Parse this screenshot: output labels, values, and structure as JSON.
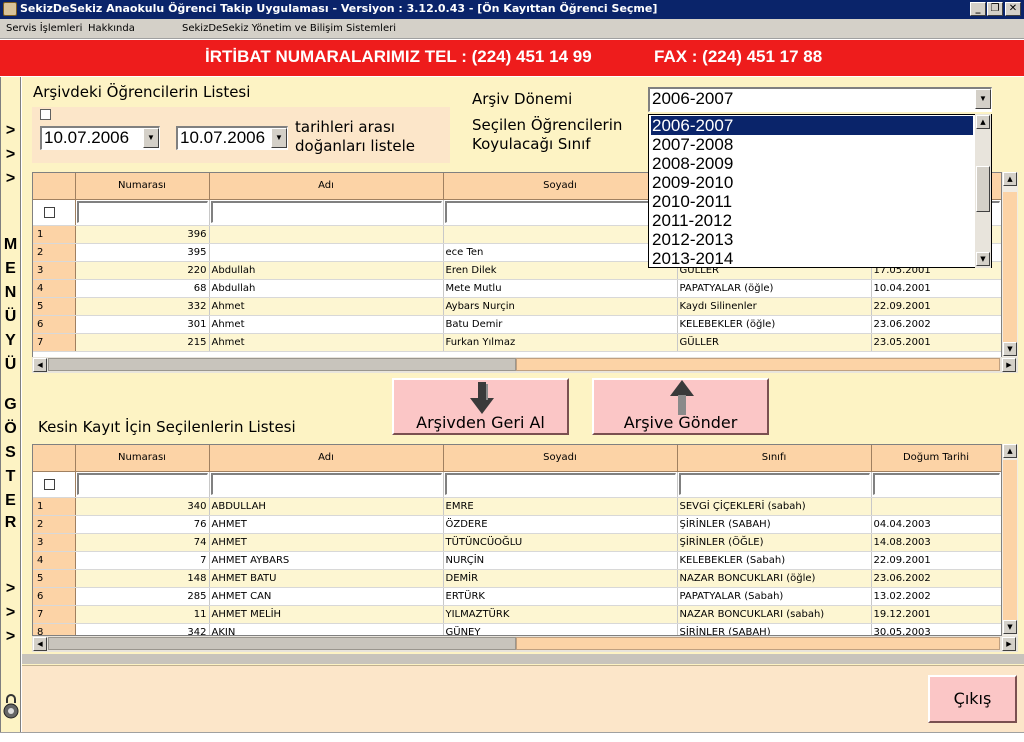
{
  "window": {
    "title": "SekizDeSekiz Anaokulu Öğrenci Takip Uygulaması - Versiyon : 3.12.0.43 - [Ön Kayıttan Öğrenci Seçme]"
  },
  "menu": {
    "items": [
      "Servis İşlemleri",
      "Hakkında"
    ],
    "right_label": "SekizDeSekiz Yönetim ve Bilişim Sistemleri"
  },
  "banner": {
    "tel": "İRTİBAT NUMARALARIMIZ  TEL : (224) 451 14 99",
    "fax": "FAX : (224) 451 17 88",
    "color": "#ee1c1c"
  },
  "side_menu": {
    "arrows_top": [
      ">",
      ">",
      ">"
    ],
    "letters": [
      "M",
      "E",
      "N",
      "Ü",
      "Y",
      "Ü",
      "",
      "G",
      "Ö",
      "S",
      "T",
      "E",
      "R"
    ],
    "arrows_bottom": [
      ">",
      ">",
      ">"
    ]
  },
  "archive": {
    "title": "Arşivdeki Öğrencilerin Listesi",
    "date_from": "10.07.2006",
    "date_to": "10.07.2006",
    "date_label_line1": "tarihleri arası",
    "date_label_line2": "doğanları listele",
    "period_label": "Arşiv Dönemi",
    "target_label_line1": "Seçilen Öğrencilerin",
    "target_label_line2": "Koyulacağı Sınıf",
    "period_value": "2006-2007",
    "period_options": [
      "2006-2007",
      "2007-2008",
      "2008-2009",
      "2009-2010",
      "2010-2011",
      "2011-2012",
      "2012-2013",
      "2013-2014"
    ],
    "columns": [
      "Numarası",
      "Adı",
      "Soyadı",
      "",
      ""
    ],
    "rows": [
      {
        "no": "1",
        "num": "396",
        "name": "",
        "surname": "",
        "cls": "",
        "dob": ""
      },
      {
        "no": "2",
        "num": "395",
        "name": "",
        "surname": "ece Ten",
        "cls": "",
        "dob": ""
      },
      {
        "no": "3",
        "num": "220",
        "name": "Abdullah",
        "surname": "Eren Dilek",
        "cls": "GÜLLER",
        "dob": "17.05.2001"
      },
      {
        "no": "4",
        "num": "68",
        "name": "Abdullah",
        "surname": "Mete Mutlu",
        "cls": "PAPATYALAR (öğle)",
        "dob": "10.04.2001"
      },
      {
        "no": "5",
        "num": "332",
        "name": "Ahmet",
        "surname": "Aybars Nurçin",
        "cls": "Kaydı Silinenler",
        "dob": "22.09.2001"
      },
      {
        "no": "6",
        "num": "301",
        "name": "Ahmet",
        "surname": "Batu Demir",
        "cls": "KELEBEKLER (öğle)",
        "dob": "23.06.2002"
      },
      {
        "no": "7",
        "num": "215",
        "name": "Ahmet",
        "surname": "Furkan Yılmaz",
        "cls": "GÜLLER",
        "dob": "23.05.2001"
      }
    ]
  },
  "buttons": {
    "restore": "Arşivden Geri Al",
    "archive": "Arşive Gönder",
    "exit": "Çıkış"
  },
  "final": {
    "title": "Kesin Kayıt İçin Seçilenlerin Listesi",
    "columns": [
      "Numarası",
      "Adı",
      "Soyadı",
      "Sınıfı",
      "Doğum Tarihi"
    ],
    "rows": [
      {
        "no": "1",
        "num": "340",
        "name": "ABDULLAH",
        "surname": "EMRE",
        "cls": "SEVGİ ÇİÇEKLERİ (sabah)",
        "dob": ""
      },
      {
        "no": "2",
        "num": "76",
        "name": "AHMET",
        "surname": "ÖZDERE",
        "cls": "ŞİRİNLER (SABAH)",
        "dob": "04.04.2003"
      },
      {
        "no": "3",
        "num": "74",
        "name": "AHMET",
        "surname": "TÜTÜNCÜOĞLU",
        "cls": "ŞİRİNLER (ÖĞLE)",
        "dob": "14.08.2003"
      },
      {
        "no": "4",
        "num": "7",
        "name": "AHMET AYBARS",
        "surname": "NURÇİN",
        "cls": "KELEBEKLER (Sabah)",
        "dob": "22.09.2001"
      },
      {
        "no": "5",
        "num": "148",
        "name": "AHMET BATU",
        "surname": "DEMİR",
        "cls": "NAZAR BONCUKLARI (öğle)",
        "dob": "23.06.2002"
      },
      {
        "no": "6",
        "num": "285",
        "name": "AHMET CAN",
        "surname": "ERTÜRK",
        "cls": "PAPATYALAR (Sabah)",
        "dob": "13.02.2002"
      },
      {
        "no": "7",
        "num": "11",
        "name": "AHMET MELİH",
        "surname": "YILMAZTÜRK",
        "cls": "NAZAR BONCUKLARI (sabah)",
        "dob": "19.12.2001"
      },
      {
        "no": "8",
        "num": "342",
        "name": "AKIN",
        "surname": "GÜNEY",
        "cls": "ŞİRİNLER (SABAH)",
        "dob": "30.05.2003"
      }
    ]
  }
}
